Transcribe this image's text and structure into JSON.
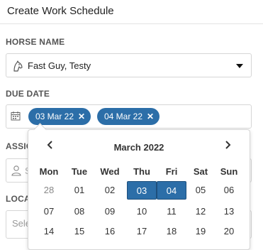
{
  "header": {
    "title": "Create Work Schedule"
  },
  "horse": {
    "label": "HORSE NAME",
    "value": "Fast Guy, Testy",
    "icon": "horse-head-icon"
  },
  "due_date": {
    "label": "DUE DATE",
    "icon": "calendar-icon",
    "chips": [
      {
        "label": "03 Mar 22",
        "remove": "✕"
      },
      {
        "label": "04 Mar 22",
        "remove": "✕"
      }
    ]
  },
  "assign": {
    "label": "ASSIG",
    "icon": "user-icon",
    "partial": "S"
  },
  "location": {
    "label": "LOCA",
    "placeholder": "Sele"
  },
  "calendar": {
    "month_label": "March 2022",
    "prev": "‹",
    "next": "›",
    "weekdays": [
      "Mon",
      "Tue",
      "Wed",
      "Thu",
      "Fri",
      "Sat",
      "Sun"
    ],
    "weeks": [
      [
        {
          "d": "28",
          "muted": true
        },
        {
          "d": "01"
        },
        {
          "d": "02"
        },
        {
          "d": "03",
          "selected": true
        },
        {
          "d": "04",
          "selected": true
        },
        {
          "d": "05"
        },
        {
          "d": "06"
        }
      ],
      [
        {
          "d": "07"
        },
        {
          "d": "08"
        },
        {
          "d": "09"
        },
        {
          "d": "10"
        },
        {
          "d": "11"
        },
        {
          "d": "12"
        },
        {
          "d": "13"
        }
      ],
      [
        {
          "d": "14"
        },
        {
          "d": "15"
        },
        {
          "d": "16"
        },
        {
          "d": "17"
        },
        {
          "d": "18"
        },
        {
          "d": "19"
        },
        {
          "d": "20"
        }
      ]
    ],
    "selected_color": "#2c6ea8"
  }
}
